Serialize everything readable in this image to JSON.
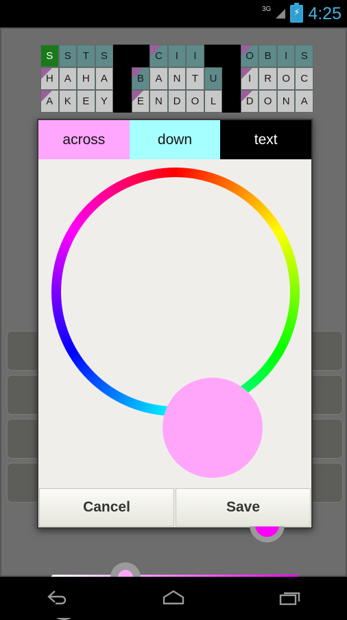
{
  "status_bar": {
    "network_label": "3G",
    "time": "4:25",
    "signal_icon": "signal-triangle-icon",
    "battery_icon": "battery-charging-icon",
    "clock_color": "#3fb4e0"
  },
  "crossword": {
    "rows": [
      [
        {
          "letter": "S",
          "state": "current"
        },
        {
          "letter": "S",
          "state": "highlight"
        },
        {
          "letter": "T",
          "state": "highlight"
        },
        {
          "letter": "S",
          "state": "highlight"
        },
        {
          "letter": "",
          "state": "block"
        },
        {
          "letter": "",
          "state": "block"
        },
        {
          "letter": "C",
          "state": "highlight",
          "corner": true
        },
        {
          "letter": "I",
          "state": "highlight"
        },
        {
          "letter": "I",
          "state": "highlight"
        },
        {
          "letter": "",
          "state": "block"
        },
        {
          "letter": "",
          "state": "block"
        },
        {
          "letter": "O",
          "state": "highlight",
          "corner": true
        },
        {
          "letter": "B",
          "state": "highlight"
        },
        {
          "letter": "I",
          "state": "highlight"
        },
        {
          "letter": "S",
          "state": "highlight"
        }
      ],
      [
        {
          "letter": "H",
          "state": "normal",
          "corner": true
        },
        {
          "letter": "A",
          "state": "normal"
        },
        {
          "letter": "H",
          "state": "normal"
        },
        {
          "letter": "A",
          "state": "normal"
        },
        {
          "letter": "",
          "state": "block"
        },
        {
          "letter": "B",
          "state": "highlight",
          "corner": true
        },
        {
          "letter": "A",
          "state": "normal"
        },
        {
          "letter": "N",
          "state": "normal"
        },
        {
          "letter": "T",
          "state": "normal"
        },
        {
          "letter": "U",
          "state": "highlight"
        },
        {
          "letter": "",
          "state": "block"
        },
        {
          "letter": "I",
          "state": "normal",
          "corner": true
        },
        {
          "letter": "R",
          "state": "normal"
        },
        {
          "letter": "O",
          "state": "normal"
        },
        {
          "letter": "C",
          "state": "normal"
        }
      ],
      [
        {
          "letter": "A",
          "state": "normal",
          "corner": true
        },
        {
          "letter": "K",
          "state": "normal"
        },
        {
          "letter": "E",
          "state": "normal"
        },
        {
          "letter": "Y",
          "state": "normal"
        },
        {
          "letter": "",
          "state": "block"
        },
        {
          "letter": "E",
          "state": "normal",
          "corner": true
        },
        {
          "letter": "N",
          "state": "normal"
        },
        {
          "letter": "D",
          "state": "normal"
        },
        {
          "letter": "O",
          "state": "normal"
        },
        {
          "letter": "L",
          "state": "normal"
        },
        {
          "letter": "",
          "state": "block"
        },
        {
          "letter": "D",
          "state": "normal",
          "corner": true
        },
        {
          "letter": "O",
          "state": "normal"
        },
        {
          "letter": "N",
          "state": "normal"
        },
        {
          "letter": "A",
          "state": "normal"
        }
      ]
    ],
    "current_cell_color": "#1a7a1a",
    "highlight_color": "#5e8a8a",
    "corner_color": "#9b5f9b",
    "block_color": "#000000"
  },
  "dialog": {
    "tabs": [
      {
        "label": "across",
        "bg": "#ffa6ff",
        "fg": "#151515",
        "selected": false
      },
      {
        "label": "down",
        "bg": "#a6ffff",
        "fg": "#151515",
        "selected": false
      },
      {
        "label": "text",
        "bg": "#000000",
        "fg": "#ffffff",
        "selected": true
      }
    ],
    "color_picker": {
      "selected_hue_color": "#ff00ff",
      "preview_color": "#ffa6fa",
      "saturation": {
        "label": "saturation-slider",
        "from": "#ffffff",
        "to": "#ff00ff",
        "value_percent": 30
      },
      "value": {
        "label": "brightness-slider",
        "from": "#ffa6fa",
        "to": "#000000",
        "value_percent": 5
      },
      "hue_handle_color": "#ff00ff",
      "handle_ring_color": "#9a9a9a"
    },
    "buttons": {
      "cancel": "Cancel",
      "save": "Save"
    }
  },
  "nav_bar": {
    "back": "back-icon",
    "home": "home-icon",
    "recents": "recent-apps-icon"
  }
}
